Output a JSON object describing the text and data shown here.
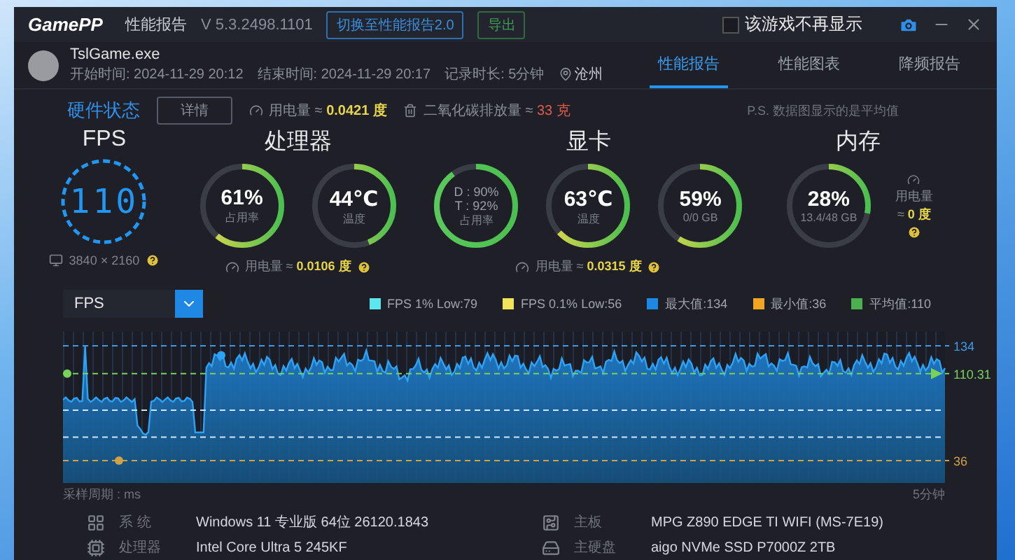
{
  "header": {
    "logo": "GamePP",
    "title": "性能报告",
    "version": "V 5.3.2498.1101",
    "buttons": [
      {
        "label": "切换至性能报告2.0",
        "kind": "switch"
      },
      {
        "label": "导出",
        "kind": "export"
      }
    ],
    "hide_option": {
      "label": "该游戏不再显示",
      "checked": false
    }
  },
  "session": {
    "game": "TslGame.exe",
    "start": "开始时间: 2024-11-29 20:12",
    "end": "结束时间: 2024-11-29 20:17",
    "duration": "记录时长: 5分钟",
    "location": "沧州"
  },
  "tabs": [
    {
      "label": "性能报告",
      "selected": true
    },
    {
      "label": "性能图表",
      "selected": false
    },
    {
      "label": "降频报告",
      "selected": false
    }
  ],
  "status": {
    "title": "硬件状态",
    "details_button": "详情",
    "power_label": "用电量 ≈",
    "power_value": "0.0421 度",
    "co2_label": "二氧化碳排放量 ≈",
    "co2_value": "33 克",
    "note": "P.S. 数据图显示的是平均值"
  },
  "sections": [
    {
      "title": "FPS",
      "gauges": [
        {
          "kind": "fps",
          "value": "110"
        }
      ],
      "footer": {
        "kind": "resolution",
        "text": "3840 × 2160"
      }
    },
    {
      "title": "处理器",
      "gauges": [
        {
          "kind": "ring",
          "value": "61%",
          "label": "占用率",
          "level": 0.61
        },
        {
          "kind": "ring",
          "value": "44℃",
          "label": "温度",
          "level": 0.44
        }
      ],
      "footer": {
        "kind": "power",
        "label": "用电量 ≈",
        "value": "0.0106 度"
      }
    },
    {
      "title": "显卡",
      "gauges": [
        {
          "kind": "dual",
          "lines": [
            "D : 90%",
            "T : 92%"
          ],
          "label": "占用率",
          "level": 0.9
        },
        {
          "kind": "ring",
          "value": "63℃",
          "label": "温度",
          "level": 0.63
        },
        {
          "kind": "ring",
          "value": "59%",
          "label": "0/0 GB",
          "level": 0.59
        }
      ],
      "footer": {
        "kind": "power",
        "label": "用电量 ≈",
        "value": "0.0315 度"
      }
    },
    {
      "title": "内存",
      "gauges": [
        {
          "kind": "ring",
          "value": "28%",
          "label": "13.4/48 GB",
          "level": 0.28
        }
      ],
      "footer": {
        "kind": "power_side",
        "label": "用电量 ≈",
        "value": "0 度"
      }
    }
  ],
  "chart": {
    "selector": "FPS",
    "legend": [
      {
        "label": "FPS 1% Low:79",
        "color": "#5ee6ee"
      },
      {
        "label": "FPS 0.1% Low:56",
        "color": "#f2e45a"
      },
      {
        "label": "最大值:134",
        "color": "#1e88e5"
      },
      {
        "label": "最小值:36",
        "color": "#f0a623"
      },
      {
        "label": "平均值:110",
        "color": "#4caf50"
      }
    ],
    "marks": [
      {
        "kind": "max",
        "label": "134"
      },
      {
        "kind": "avg",
        "label": "110.31"
      },
      {
        "kind": "min",
        "label": "36"
      }
    ],
    "x_left": "采样周期 : ms",
    "x_right": "5分钟"
  },
  "specs": [
    {
      "kind": "system",
      "label": "系 统",
      "value": "Windows 11 专业版 64位 26120.1843"
    },
    {
      "kind": "board",
      "label": "主板",
      "value": "MPG Z890 EDGE TI WIFI (MS-7E19)"
    },
    {
      "kind": "cpu",
      "label": "处理器",
      "value": "Intel Core Ultra 5 245KF"
    },
    {
      "kind": "disk",
      "label": "主硬盘",
      "value": "aigo NVMe SSD P7000Z 2TB"
    }
  ]
}
